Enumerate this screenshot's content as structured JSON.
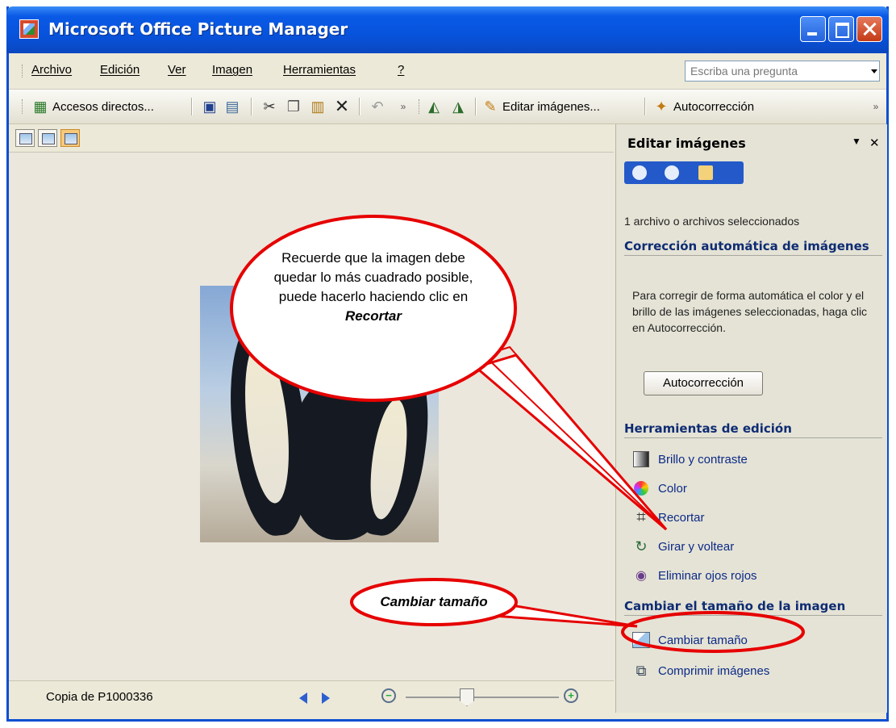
{
  "window": {
    "title": "Microsoft Office Picture Manager"
  },
  "menubar": {
    "items": [
      "Archivo",
      "Edición",
      "Ver",
      "Imagen",
      "Herramientas",
      "?"
    ],
    "help_placeholder": "Escriba una pregunta"
  },
  "toolbar": {
    "shortcuts_label": "Accesos directos...",
    "edit_images_label": "Editar imágenes...",
    "autocorrect_label": "Autocorrección"
  },
  "viewer": {
    "filename": "Copia de P1000336",
    "zoom_level": 0.4
  },
  "task_pane": {
    "title": "Editar imágenes",
    "selection_info": "1 archivo o archivos seleccionados",
    "auto_correction": {
      "heading": "Corrección automática de imágenes",
      "description": "Para corregir de forma automática el color y el brillo de las imágenes seleccionadas, haga clic en Autocorrección.",
      "button": "Autocorrección"
    },
    "editing_tools": {
      "heading": "Herramientas de edición",
      "items": [
        "Brillo y contraste",
        "Color",
        "Recortar",
        "Girar y voltear",
        "Eliminar ojos rojos"
      ]
    },
    "resize": {
      "heading": "Cambiar el tamaño de la imagen",
      "items": [
        "Cambiar tamaño",
        "Comprimir imágenes"
      ]
    }
  },
  "callouts": {
    "crop_text": "Recuerde que la imagen debe quedar lo más cuadrado posible, puede hacerlo haciendo clic en",
    "crop_emphasis": "Recortar",
    "resize_text": "Cambiar tamaño"
  },
  "colors": {
    "title_blue": "#0753dc",
    "callout_red": "#e60000",
    "pane_heading": "#0e2c73"
  }
}
